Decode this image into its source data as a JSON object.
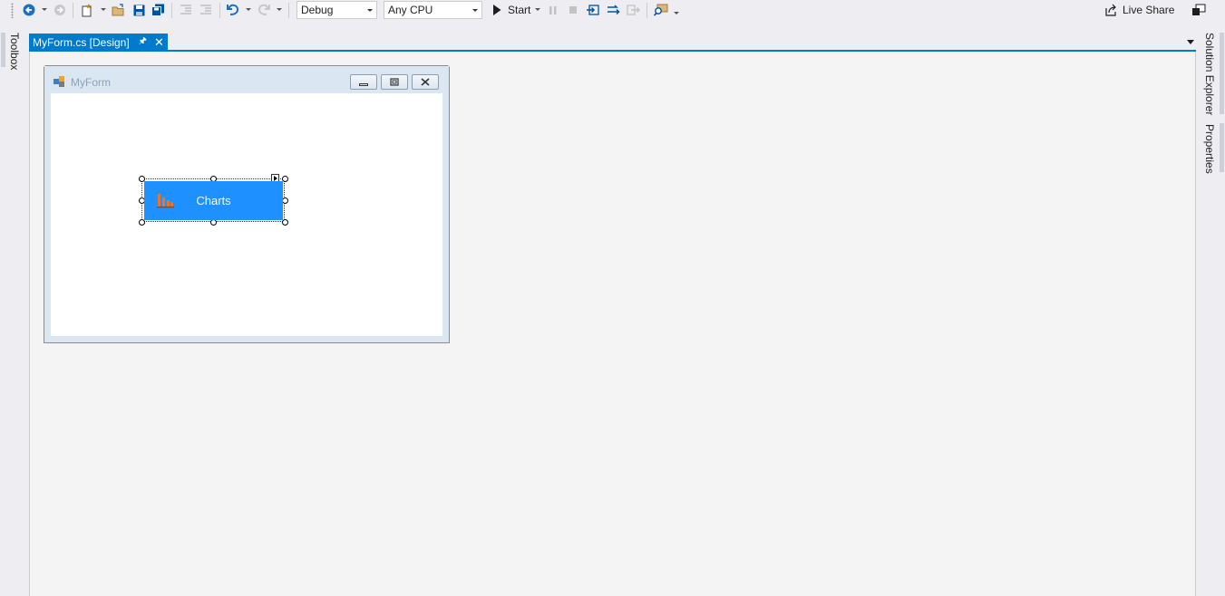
{
  "toolbar": {
    "configuration": "Debug",
    "platform": "Any CPU",
    "start_label": "Start",
    "live_share_label": "Live Share",
    "icons": [
      "back-icon",
      "forward-icon",
      "new-project-icon",
      "open-folder-icon",
      "save-icon",
      "save-all-icon",
      "outdent-icon",
      "indent-icon",
      "undo-icon",
      "redo-icon",
      "play-icon",
      "pause-icon",
      "stop-icon",
      "step-into-icon",
      "step-over-icon",
      "step-out-icon",
      "find-icon",
      "live-share-icon",
      "feedback-icon"
    ]
  },
  "left_panel": {
    "toolbox_label": "Toolbox"
  },
  "right_panel": {
    "solution_explorer_label": "Solution Explorer",
    "properties_label": "Properties"
  },
  "document_tab": {
    "title": "MyForm.cs [Design]"
  },
  "form": {
    "title": "MyForm",
    "button": {
      "label": "Charts",
      "color": "#1e90ff",
      "icon": "bar-chart-icon"
    }
  },
  "colors": {
    "accent": "#007acc",
    "background": "#eeeef2",
    "designer": "#f4f4f4"
  }
}
